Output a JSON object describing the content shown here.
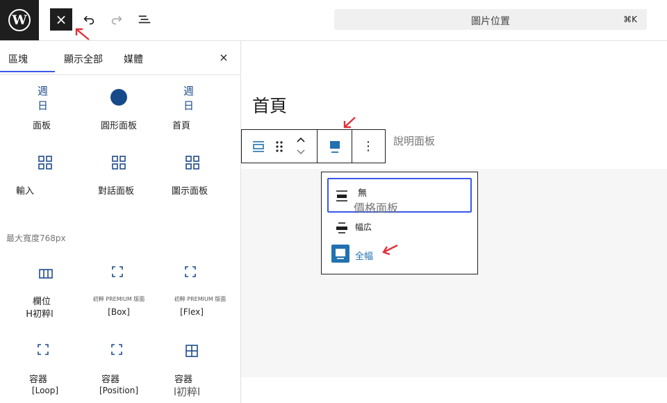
{
  "header": {
    "close_label": "×",
    "command_title": "圖片位置",
    "command_shortcut": "⌘K"
  },
  "inserter": {
    "tabs": [
      "區塊",
      "顯示全部",
      "媒體"
    ],
    "close_label": "×",
    "items_row1": [
      {
        "icon_text": "週日",
        "label": "面板",
        "icon": "text-icon"
      },
      {
        "icon_text": "",
        "label": "圓形面板",
        "icon": "circle-icon"
      },
      {
        "icon_text": "週日",
        "label": "首頁",
        "icon": "text-icon"
      }
    ],
    "items_row2": [
      {
        "label": "輸入",
        "icon": "grid-icon"
      },
      {
        "label": "對話面板",
        "icon": "grid-icon"
      },
      {
        "label": "圖示面板",
        "icon": "grid-icon"
      }
    ],
    "section_title": "最大寬度768px",
    "items_row3": [
      {
        "small": "",
        "label1": "欄位",
        "label2": "H初粹l",
        "icon": "columns-icon"
      },
      {
        "small": "初粹 PREMIUM 版面",
        "label1": "",
        "label2": "[Box]",
        "icon": "corners-icon"
      },
      {
        "small": "初粹 PREMIUM 版面",
        "label1": "",
        "label2": "[Flex]",
        "icon": "corners-icon"
      }
    ],
    "items_row4": [
      {
        "label1": "容器",
        "label2": "[Loop]",
        "icon": "corners-icon"
      },
      {
        "label1": "容器",
        "label2": "[Position]",
        "icon": "corners-icon"
      },
      {
        "label1": "容器",
        "label2": "l初粹l",
        "icon": "table-icon"
      }
    ]
  },
  "editor": {
    "page_title": "首頁",
    "hint": "說明面板"
  },
  "toolbar": {
    "more_label": "⋮"
  },
  "alignment_menu": {
    "options": [
      {
        "label": "無",
        "description": "價格面板"
      },
      {
        "label": "幅広"
      },
      {
        "label": "全幅"
      }
    ]
  },
  "colors": {
    "accent": "#3858e9",
    "active_blue": "#2271b1",
    "arrow_red": "#e0313b"
  }
}
